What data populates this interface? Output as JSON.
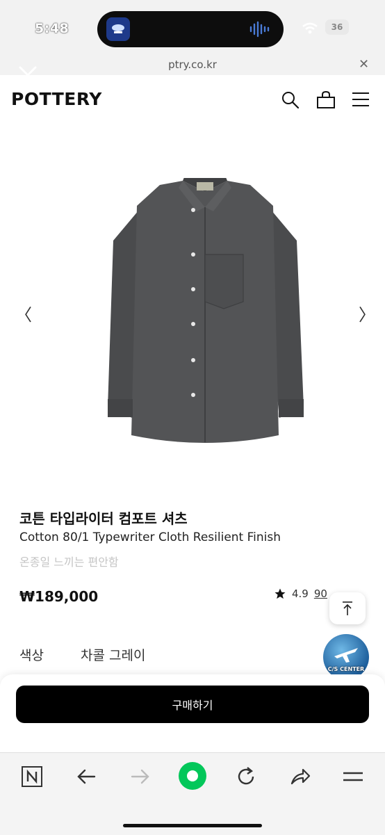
{
  "status_bar": {
    "time": "5:48",
    "battery": "36"
  },
  "browser": {
    "url": "ptry.co.kr"
  },
  "site": {
    "logo": "POTTERY"
  },
  "product": {
    "title_ko": "코튼 타입라이터 컴포트 셔츠",
    "title_en": "Cotton 80/1 Typewriter Cloth Resilient Finish",
    "subtitle": "온종일 느끼는 편안함",
    "price": "₩189,000",
    "rating": "4.9",
    "review_count": "90",
    "color_label": "색상",
    "color_value": "차콜 그레이",
    "image_alt": "charcoal gray shirt"
  },
  "buttons": {
    "buy": "구매하기",
    "cs_center": "C/S CENTER"
  },
  "icons": {
    "search": "search-icon",
    "bag": "shopping-bag-icon",
    "menu": "hamburger-menu-icon",
    "close": "close-icon",
    "prev": "chevron-left-icon",
    "next": "chevron-right-icon",
    "top": "arrow-up-icon",
    "star": "star-icon"
  },
  "colors": {
    "accent": "#000000",
    "naver_green": "#03c75a",
    "shirt": "#4a4b4d"
  }
}
